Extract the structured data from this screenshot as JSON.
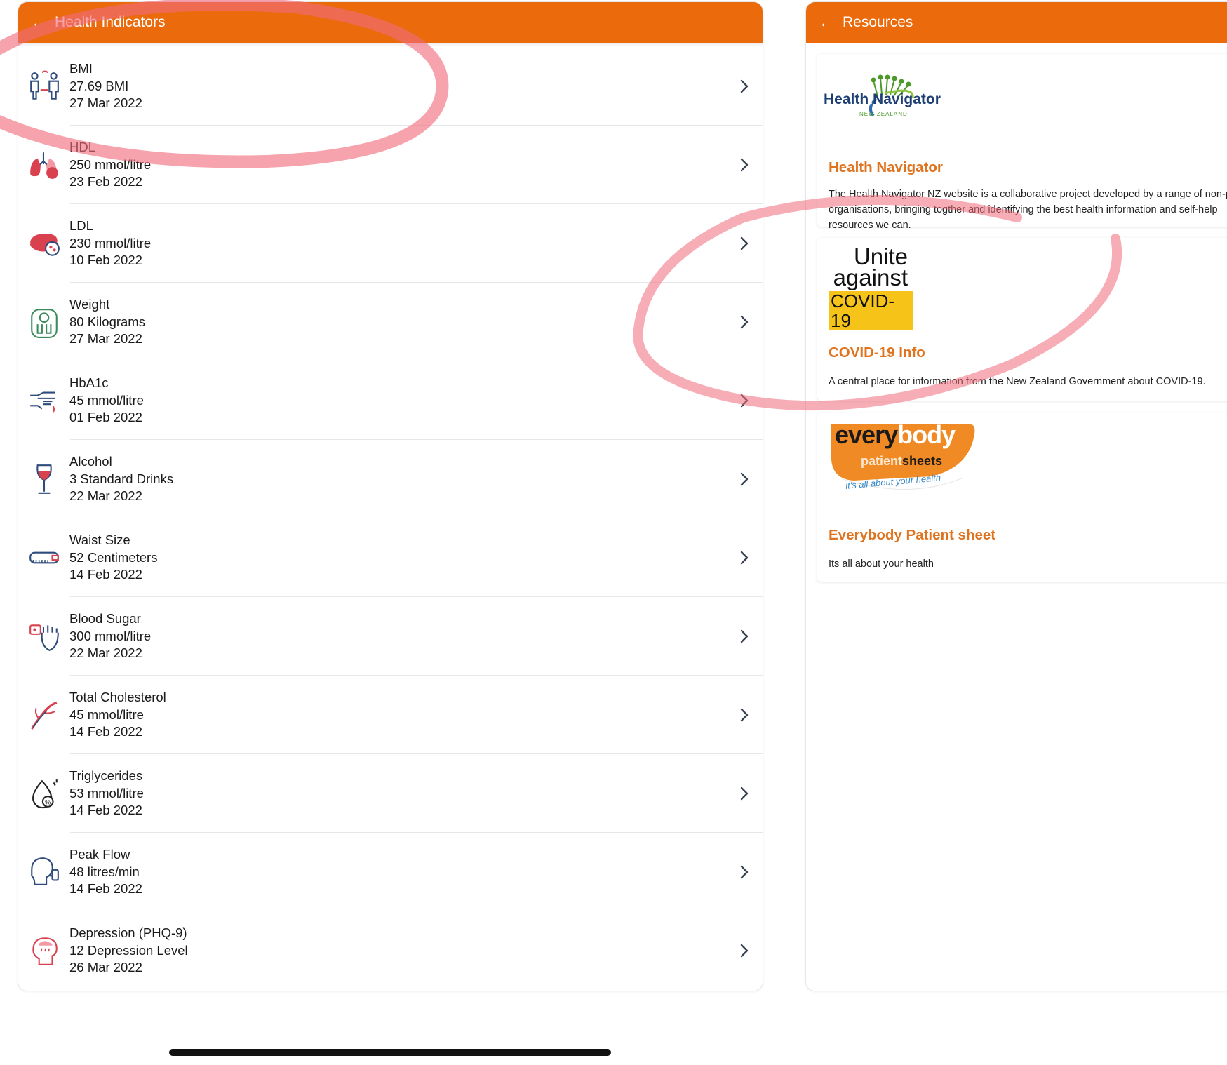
{
  "health_panel": {
    "title": "Health Indicators",
    "back_icon": "arrow-left-icon",
    "rows": [
      {
        "name": "BMI",
        "value": "27.69 BMI",
        "date": "27 Mar 2022",
        "icon": "people-measure-icon"
      },
      {
        "name": "HDL",
        "value": "250 mmol/litre",
        "date": "23 Feb 2022",
        "icon": "lungs-icon"
      },
      {
        "name": "LDL",
        "value": "230 mmol/litre",
        "date": "10 Feb 2022",
        "icon": "liver-icon"
      },
      {
        "name": "Weight",
        "value": "80 Kilograms",
        "date": "27 Mar 2022",
        "icon": "scale-icon"
      },
      {
        "name": "HbA1c",
        "value": "45 mmol/litre",
        "date": "01 Feb 2022",
        "icon": "finger-prick-icon"
      },
      {
        "name": "Alcohol",
        "value": "3 Standard Drinks",
        "date": "22 Mar 2022",
        "icon": "wine-glass-icon"
      },
      {
        "name": "Waist Size",
        "value": "52 Centimeters",
        "date": "14 Feb 2022",
        "icon": "tape-measure-icon"
      },
      {
        "name": "Blood Sugar",
        "value": "300 mmol/litre",
        "date": "22 Mar 2022",
        "icon": "glucose-meter-icon"
      },
      {
        "name": "Total Cholesterol",
        "value": "45 mmol/litre",
        "date": "14 Feb 2022",
        "icon": "artery-icon"
      },
      {
        "name": "Triglycerides",
        "value": "53 mmol/litre",
        "date": "14 Feb 2022",
        "icon": "fat-drop-icon"
      },
      {
        "name": "Peak Flow",
        "value": "48 litres/min",
        "date": "14 Feb 2022",
        "icon": "inhaler-icon"
      },
      {
        "name": "Depression (PHQ-9)",
        "value": "12 Depression Level",
        "date": "26 Mar 2022",
        "icon": "head-rain-icon"
      }
    ]
  },
  "resources_panel": {
    "title": "Resources",
    "back_icon": "arrow-left-icon",
    "cards": [
      {
        "logo": {
          "word1": "Health",
          "word2": "Navigator",
          "sub": "NEW ZEALAND"
        },
        "title": "Health Navigator",
        "description": "The Health Navigator NZ website is a collaborative project developed by a range of non-profit organisations, bringing togther and identifying the best health information and self-help resources we can."
      },
      {
        "logo": {
          "line1": "Unite",
          "line2": "against",
          "line3": "COVID-19"
        },
        "title": "COVID-19 Info",
        "description": "A central place for information from the New Zealand Government about COVID-19."
      },
      {
        "logo": {
          "every": "every",
          "body": "body",
          "patient": "patient",
          "sheets": "sheets",
          "tagline": "it's all about your health"
        },
        "title": "Everybody Patient sheet",
        "description": "Its all about your health"
      }
    ]
  },
  "colors": {
    "header": "#ea6a0c",
    "card_title": "#e0731e",
    "covid_yellow": "#f6c418",
    "scribble": "#f06a7a",
    "icon_blue": "#2f4b7c",
    "icon_red": "#d9414e"
  }
}
